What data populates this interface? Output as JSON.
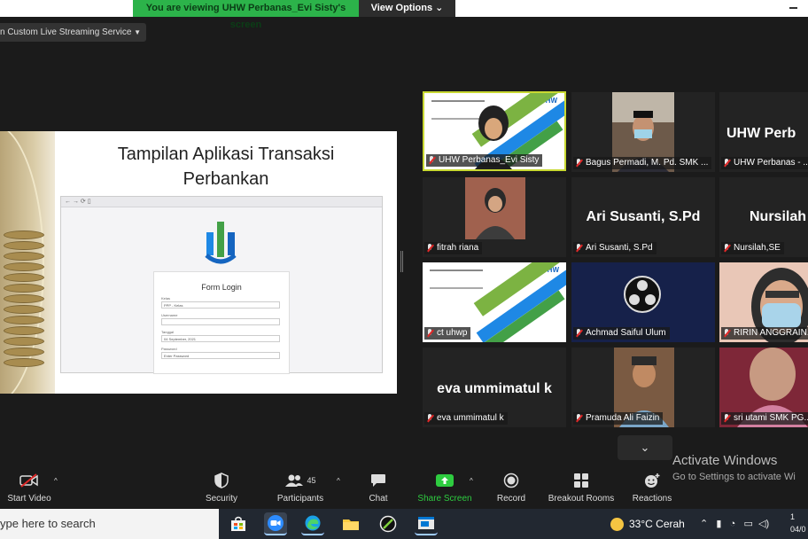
{
  "banner": {
    "viewing": "You are viewing UHW Perbanas_Evi Sisty's screen",
    "view_options": "View Options"
  },
  "live_stream": {
    "label": "n Custom Live Streaming Service"
  },
  "slide": {
    "title_line1": "Tampilan Aplikasi Transaksi",
    "title_line2": "Perbankan",
    "form": {
      "title": "Form Login",
      "fields": [
        {
          "label": "Kelas",
          "value": "PPP - Kelas"
        },
        {
          "label": "Username",
          "value": ""
        },
        {
          "label": "Tanggal",
          "value": "04 September, 2021"
        },
        {
          "label": "Password",
          "value": "Enter Password"
        }
      ]
    }
  },
  "gallery": {
    "tiles": [
      {
        "name": "UHW Perbanas_Evi Sisty",
        "display": ""
      },
      {
        "name": "Bagus Permadi, M. Pd. SMK ...",
        "display": ""
      },
      {
        "name": "UHW Perbanas - ...",
        "display": "UHW Perb"
      },
      {
        "name": "fitrah riana",
        "display": ""
      },
      {
        "name": "Ari Susanti, S.Pd",
        "display": "Ari Susanti, S.Pd"
      },
      {
        "name": "Nursilah,SE",
        "display": "Nursilah"
      },
      {
        "name": "ct uhwp",
        "display": ""
      },
      {
        "name": "Achmad Saiful Ulum",
        "display": ""
      },
      {
        "name": "RIRIN ANGGRAIN...",
        "display": ""
      },
      {
        "name": "eva ummimatul k",
        "display": "eva ummimatul k"
      },
      {
        "name": "Pramuda Ali Faizin",
        "display": ""
      },
      {
        "name": "sri utami SMK PG...",
        "display": ""
      }
    ]
  },
  "watermark": {
    "line1": "Activate Windows",
    "line2": "Go to Settings to activate Wi"
  },
  "toolbar": {
    "start_video": "Start Video",
    "security": "Security",
    "participants": "Participants",
    "participants_count": "45",
    "chat": "Chat",
    "share_screen": "Share Screen",
    "record": "Record",
    "breakout": "Breakout Rooms",
    "reactions": "Reactions"
  },
  "taskbar": {
    "search": "ype here to search",
    "weather": "33°C  Cerah",
    "time": "1",
    "date": "04/0"
  },
  "colors": {
    "share_green": "#2ecc40",
    "banner_green": "#2cb34a",
    "active_border": "#c8d832",
    "muted_red": "#e02828"
  }
}
